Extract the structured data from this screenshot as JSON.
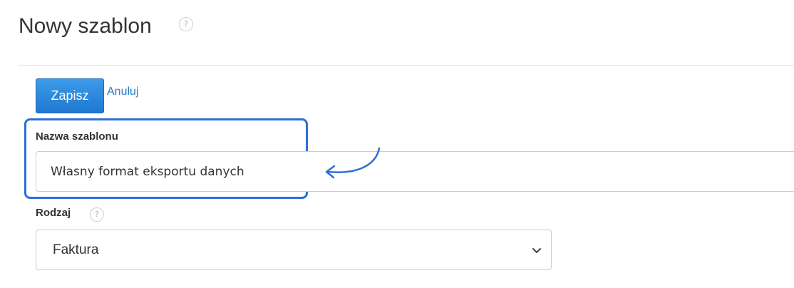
{
  "header": {
    "title": "Nowy szablon",
    "help_glyph": "?"
  },
  "toolbar": {
    "save_label": "Zapisz",
    "cancel_label": "Anuluj"
  },
  "form": {
    "name": {
      "label": "Nazwa szablonu",
      "value": "Własny format eksportu danych"
    },
    "kind": {
      "label": "Rodzaj",
      "help_glyph": "?",
      "selected": "Faktura"
    }
  },
  "colors": {
    "accent": "#1f78d1",
    "highlight": "#2d6fd6",
    "link": "#2a7cc7"
  }
}
